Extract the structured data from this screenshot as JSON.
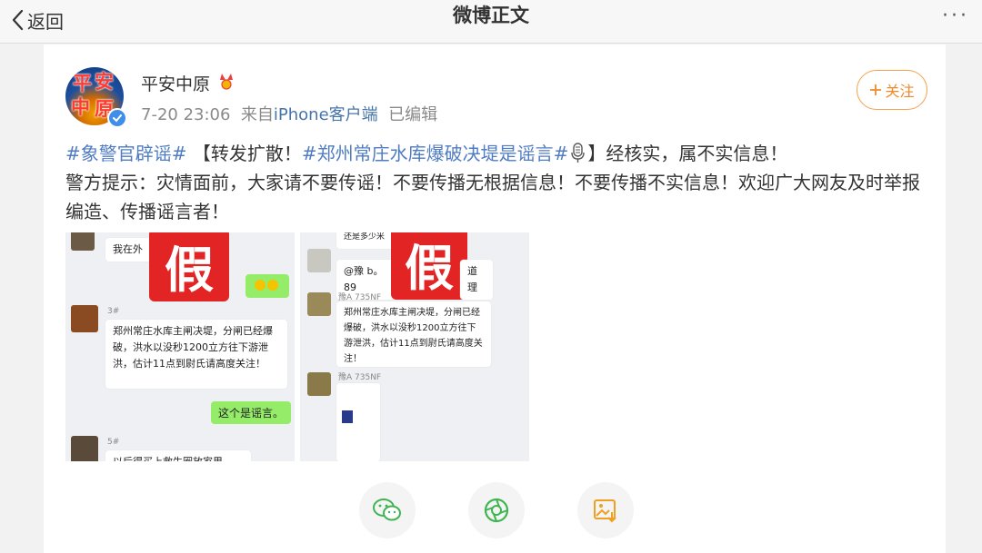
{
  "nav": {
    "back_label": "返回",
    "title": "微博正文",
    "more": "···"
  },
  "post": {
    "username": "平安中原",
    "timestamp": "7-20 23:06",
    "source_prefix": "来自",
    "source": "iPhone客户端",
    "edited": "已编辑",
    "follow_label": "关注",
    "avatar_text": [
      "平",
      "安",
      "中",
      "原"
    ],
    "line1": {
      "topic1": "#象警官辟谣#",
      "text1": "【转发扩散！",
      "topic2": "#郑州常庄水库爆破决堤是谣言#",
      "text2": "】经核实，属不实信息！"
    },
    "line2": "警方提示：灾情面前，大家请不要传谣！不要传播无根据信息！不要传播不实信息！欢迎广大网友及时举报编造、传播谣言者！"
  },
  "images": {
    "fake_label": "假",
    "image1": {
      "bubble_top": "我在外",
      "floor3": "3#",
      "rumor_text": "郑州常庄水库主闸决堤，分闸已经爆破，洪水以没秒1200立方往下游泄洪，估计11点到尉氏请高度关注！",
      "reply": "这个是谣言。",
      "floor5": "5#",
      "bottom_text": "以后得买上救生圈放家里"
    },
    "image2": {
      "top_text": "还是多少米",
      "mention": "@豫 b。89",
      "mention_tail": "道理",
      "user1": "豫A 735NF",
      "rumor_text": "郑州常庄水库主闸决堤，分闸已经爆破，洪水以没秒1200立方往下游泄洪，估计11点到尉氏请高度关注！",
      "user2": "豫A 735NF"
    }
  },
  "share": [
    {
      "icon": "wechat-icon"
    },
    {
      "icon": "moments-icon"
    },
    {
      "icon": "save-image-icon"
    }
  ],
  "colors": {
    "topic": "#4f7cc2",
    "follow": "#ee8a2b",
    "source": "#4775a9",
    "fake_red": "#e32424",
    "wechat_green": "#3fb552"
  }
}
